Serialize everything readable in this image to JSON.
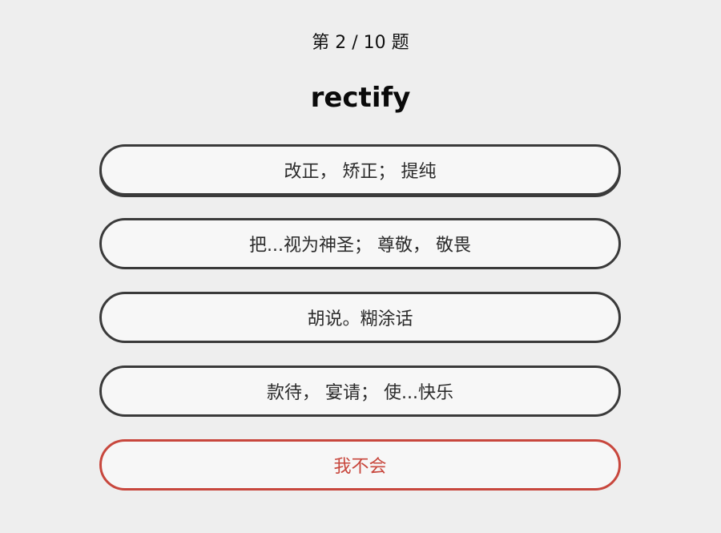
{
  "progress": "第 2 / 10 题",
  "word": "rectify",
  "options": [
    "改正， 矫正； 提纯",
    "把...视为神圣； 尊敬， 敬畏",
    "胡说。糊涂话",
    "款待， 宴请； 使...快乐"
  ],
  "dont_know": "我不会",
  "colors": {
    "background": "#eeeeee",
    "option_border": "#3a3a3a",
    "dont_know_accent": "#c8473d"
  }
}
